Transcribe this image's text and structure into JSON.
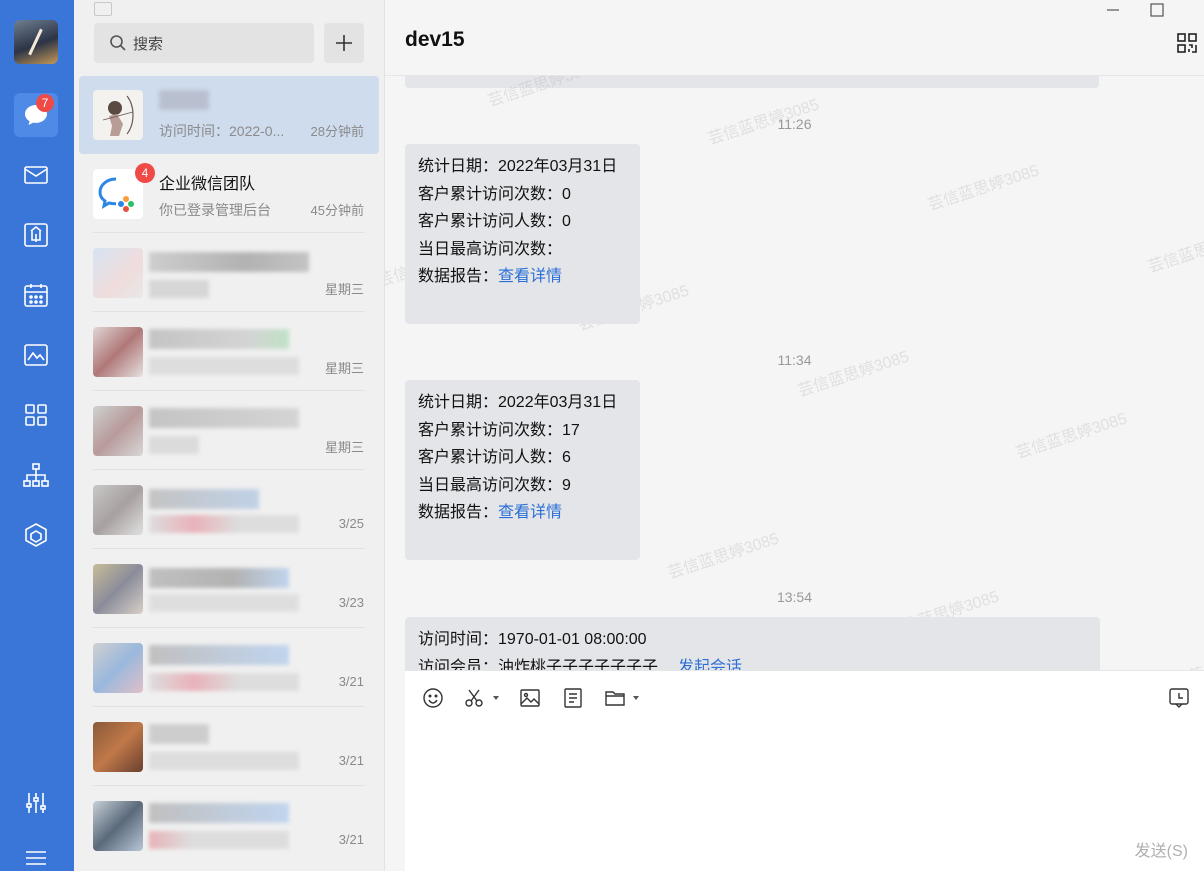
{
  "sidebar": {
    "unread_badge": "7",
    "nav_icons": [
      "message-icon",
      "mail-icon",
      "workbench-icon",
      "calendar-icon",
      "docs-icon",
      "apps-icon",
      "org-icon",
      "cube-icon",
      "settings-sliders-icon",
      "menu-icon"
    ]
  },
  "conversation_list": {
    "search_placeholder": "搜索",
    "add_button": "+",
    "items": [
      {
        "name": "",
        "preview": "访问时间：2022-0...",
        "time": "28分钟前",
        "badge": ""
      },
      {
        "name": "企业微信团队",
        "preview": "你已登录管理后台",
        "time": "45分钟前",
        "badge": "4"
      },
      {
        "name": "",
        "preview": "",
        "time": "星期三",
        "badge": ""
      },
      {
        "name": "",
        "preview": "",
        "time": "星期三",
        "badge": ""
      },
      {
        "name": "",
        "preview": "",
        "time": "星期三",
        "badge": ""
      },
      {
        "name": "",
        "preview": "",
        "time": "3/25",
        "badge": ""
      },
      {
        "name": "",
        "preview": "",
        "time": "3/23",
        "badge": ""
      },
      {
        "name": "",
        "preview": "",
        "time": "3/21",
        "badge": ""
      },
      {
        "name": "",
        "preview": "",
        "time": "3/21",
        "badge": ""
      },
      {
        "name": "",
        "preview": "",
        "time": "3/21",
        "badge": ""
      }
    ]
  },
  "chat": {
    "title": "dev15",
    "watermark": "芸信蓝思婷3085",
    "messages": [
      {
        "time": "11:26",
        "lines": [
          "统计日期：2022年03月31日",
          "客户累计访问次数：0",
          "客户累计访问人数：0",
          "当日最高访问次数："
        ],
        "report_label": "数据报告：",
        "report_link": "查看详情"
      },
      {
        "time": "11:34",
        "lines": [
          "统计日期：2022年03月31日",
          "客户累计访问次数：17",
          "客户累计访问人数：6",
          "当日最高访问次数：9"
        ],
        "report_label": "数据报告：",
        "report_link": "查看详情"
      },
      {
        "time": "13:54",
        "line1": "访问时间：1970-01-01 08:00:00",
        "line2": "访问会员：油炸桃子子子子子子子",
        "action_link": "发起会话"
      }
    ],
    "composer": {
      "tools": [
        "emoji-icon",
        "scissors-icon",
        "image-icon",
        "document-icon",
        "folder-icon",
        "history-icon"
      ],
      "send_label": "发送(S)"
    }
  },
  "colors": {
    "rail": "#3a75d8",
    "selected_item": "#cfdcee",
    "bubble": "#e4e5e9",
    "link": "#2a6fd6",
    "badge": "#f04a47"
  }
}
